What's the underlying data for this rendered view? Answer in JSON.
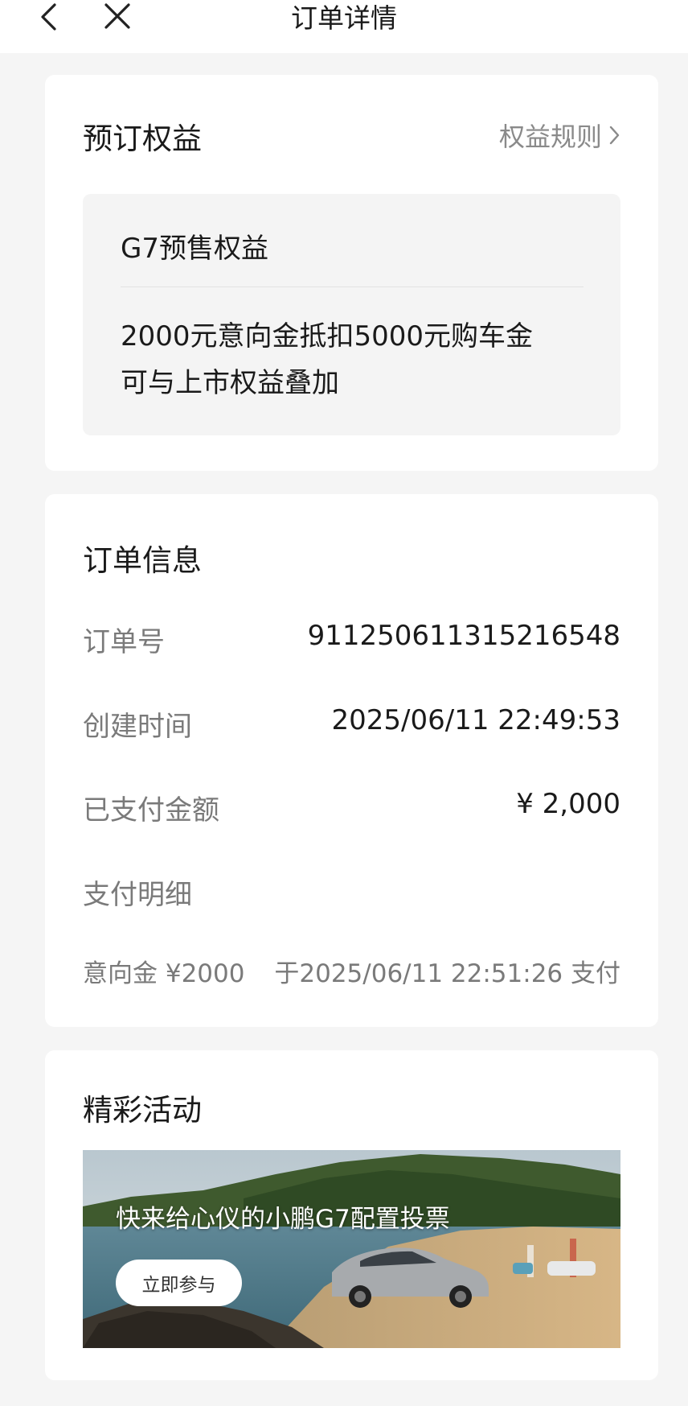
{
  "header": {
    "title": "订单详情"
  },
  "benefits": {
    "section_title": "预订权益",
    "rules_link": "权益规则",
    "card_title": "G7预售权益",
    "line1": "2000元意向金抵扣5000元购车金",
    "line2": "可与上市权益叠加"
  },
  "order_info": {
    "section_title": "订单信息",
    "order_no_label": "订单号",
    "order_no_value": "911250611315216548",
    "created_label": "创建时间",
    "created_value": "2025/06/11 22:49:53",
    "paid_label": "已支付金额",
    "paid_value": "¥ 2,000",
    "detail_label": "支付明细",
    "detail_item_label": "意向金 ¥2000",
    "detail_item_value": "于2025/06/11 22:51:26 支付"
  },
  "activities": {
    "section_title": "精彩活动",
    "banner_text": "快来给心仪的小鹏G7配置投票",
    "banner_button": "立即参与"
  },
  "icons": {
    "back": "chevron-left-icon",
    "close": "close-icon",
    "rules": "chevron-right-icon"
  }
}
